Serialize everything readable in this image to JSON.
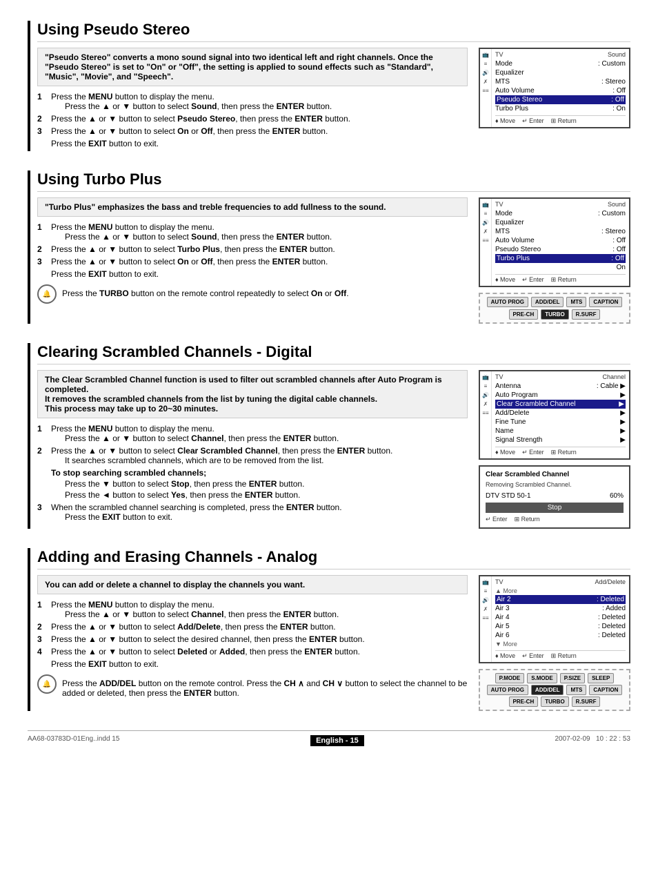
{
  "sections": [
    {
      "id": "pseudo-stereo",
      "title": "Using Pseudo Stereo",
      "intro": "\"Pseudo Stereo\" converts a mono sound signal into two identical left and right channels. Once the \"Pseudo Stereo\" is set to \"On\" or \"Off\", the setting is applied to sound effects such as \"Standard\", \"Music\", \"Movie\", and \"Speech\".",
      "steps": [
        {
          "num": "1",
          "text": "Press the MENU button to display the menu.",
          "sub": "Press the ▲ or ▼ button to select Sound, then press the ENTER button."
        },
        {
          "num": "2",
          "text": "Press the ▲ or ▼ button to select Pseudo Stereo, then press the ENTER button."
        },
        {
          "num": "3",
          "text": "Press the ▲ or ▼ button to select On or Off, then press the ENTER button."
        }
      ],
      "exit": "Press the EXIT button to exit.",
      "screen": {
        "header_left": "TV",
        "header_right": "Sound",
        "rows": [
          {
            "label": "Mode",
            "value": ": Custom",
            "selected": false
          },
          {
            "label": "Equalizer",
            "value": "",
            "selected": false
          },
          {
            "label": "MTS",
            "value": ": Stereo",
            "selected": false
          },
          {
            "label": "Auto Volume",
            "value": ": Off",
            "selected": false
          },
          {
            "label": "Pseudo Stereo",
            "value": ": Off",
            "selected": true
          },
          {
            "label": "Turbo Plus",
            "value": ": On",
            "selected": false
          }
        ],
        "footer": [
          "♦ Move",
          "↵ Enter",
          "⊞ Return"
        ],
        "icons": [
          "TV",
          "≡",
          "♪",
          "✗",
          "≡≡"
        ]
      }
    },
    {
      "id": "turbo-plus",
      "title": "Using Turbo Plus",
      "intro": "\"Turbo Plus\" emphasizes the bass and treble frequencies to add fullness to the sound.",
      "steps": [
        {
          "num": "1",
          "text": "Press the MENU button to display the menu.",
          "sub": "Press the ▲ or ▼ button to select Sound, then press the ENTER button."
        },
        {
          "num": "2",
          "text": "Press the ▲ or ▼ button to select Turbo Plus, then press the ENTER button."
        },
        {
          "num": "3",
          "text": "Press the ▲ or ▼ button to select On or Off, then press the ENTER button."
        }
      ],
      "exit": "Press the EXIT button to exit.",
      "tip": "Press the TURBO button on the remote control repeatedly to select On or Off.",
      "screen": {
        "header_left": "TV",
        "header_right": "Sound",
        "rows": [
          {
            "label": "Mode",
            "value": ": Custom",
            "selected": false
          },
          {
            "label": "Equalizer",
            "value": "",
            "selected": false
          },
          {
            "label": "MTS",
            "value": ": Stereo",
            "selected": false
          },
          {
            "label": "Auto Volume",
            "value": ": Off",
            "selected": false
          },
          {
            "label": "Pseudo Stereo",
            "value": ": Off",
            "selected": false
          },
          {
            "label": "Turbo Plus",
            "value": ": Off",
            "selected": true
          },
          {
            "label": "",
            "value": "On",
            "selected": false
          }
        ],
        "footer": [
          "♦ Move",
          "↵ Enter",
          "⊞ Return"
        ],
        "icons": [
          "TV",
          "≡",
          "♪",
          "✗",
          "≡≡"
        ]
      },
      "remote": {
        "top_buttons": [
          "AUTO PROG",
          "ADD/DEL",
          "MTS",
          "CAPTION"
        ],
        "bottom_buttons": [
          "PRE-CH",
          "TURBO",
          "R.SURF"
        ]
      }
    },
    {
      "id": "clear-scrambled",
      "title": "Clearing Scrambled Channels - Digital",
      "intro_lines": [
        "The Clear Scrambled Channel function is used to filter out scrambled channels after Auto Program is completed.",
        "It removes the scrambled channels from the list by tuning the digital cable channels.",
        "This process may take up to 20~30 minutes."
      ],
      "steps": [
        {
          "num": "1",
          "text": "Press the MENU button to display the menu.",
          "sub": "Press the ▲ or ▼ button to select Channel, then press the ENTER button."
        },
        {
          "num": "2",
          "text": "Press the ▲ or ▼ button to select Clear Scrambled Channel, then press the ENTER button.",
          "sub2": "It searches scrambled channels, which are to be removed from the list."
        },
        {
          "num": "3",
          "text": "When the scrambled channel searching is completed, press the ENTER button.",
          "sub": "Press the EXIT button to exit."
        }
      ],
      "stop_note": {
        "title": "To stop searching scrambled channels;",
        "lines": [
          "Press the ▼ button to select Stop, then press the ENTER button.",
          "Press the ◄ button to select Yes, then press the  ENTER button."
        ]
      },
      "channel_screen": {
        "header_left": "TV",
        "header_right": "Channel",
        "rows": [
          {
            "label": "Antenna",
            "value": ": Cable",
            "arrow": true,
            "selected": false
          },
          {
            "label": "Auto Program",
            "value": "",
            "arrow": true,
            "selected": false
          },
          {
            "label": "Clear Scrambled Channel",
            "value": "",
            "arrow": true,
            "selected": true
          },
          {
            "label": "Add/Delete",
            "value": "",
            "arrow": true,
            "selected": false
          },
          {
            "label": "Fine Tune",
            "value": "",
            "arrow": true,
            "selected": false
          },
          {
            "label": "Name",
            "value": "",
            "arrow": true,
            "selected": false
          },
          {
            "label": "Signal Strength",
            "value": "",
            "arrow": true,
            "selected": false
          }
        ],
        "footer": [
          "♦ Move",
          "↵ Enter",
          "⊞ Return"
        ],
        "icons": [
          "TV",
          "≡",
          "♪",
          "✗",
          "≡≡"
        ]
      },
      "csb_screen": {
        "title": "Clear Scrambled Channel",
        "subtitle": "Removing Scrambled Channel.",
        "channel": "DTV STD 50-1",
        "percent": "60%",
        "stop_btn": "Stop",
        "footer": [
          "↵ Enter",
          "⊞ Return"
        ]
      }
    },
    {
      "id": "add-erase",
      "title": "Adding and Erasing Channels - Analog",
      "intro": "You can add or delete a channel to display the channels you want.",
      "steps": [
        {
          "num": "1",
          "text": "Press the MENU button to display the menu.",
          "sub": "Press the ▲ or ▼ button to select Channel, then press the ENTER button."
        },
        {
          "num": "2",
          "text": "Press the ▲ or ▼ button to select Add/Delete, then press the ENTER button."
        },
        {
          "num": "3",
          "text": "Press the ▲ or ▼ button to select the desired channel, then press the ENTER button."
        },
        {
          "num": "4",
          "text": "Press the ▲ or ▼ button to select Deleted or Added, then press the ENTER button."
        }
      ],
      "exit": "Press the EXIT button to exit.",
      "tip": "Press the ADD/DEL button on the remote control. Press the CH ∧ and CH ∨ button to select the channel to be added or deleted, then press the ENTER button.",
      "ad_screen": {
        "header_left": "TV",
        "header_right": "Add/Delete",
        "more_top": "▲ More",
        "rows": [
          {
            "ch": "Air  2",
            "status": ": Deleted",
            "selected": true
          },
          {
            "ch": "Air  3",
            "status": ": Added",
            "selected": false
          },
          {
            "ch": "Air  4",
            "status": ": Deleted",
            "selected": false
          },
          {
            "ch": "Air  5",
            "status": ": Deleted",
            "selected": false
          },
          {
            "ch": "Air  6",
            "status": ": Deleted",
            "selected": false
          }
        ],
        "more_bottom": "▼ More",
        "footer": [
          "♦ Move",
          "↵ Enter",
          "⊞ Return"
        ],
        "icons": [
          "TV",
          "≡",
          "♪",
          "✗",
          "≡≡"
        ]
      },
      "remote2": {
        "top_buttons_1": [
          "P.MODE",
          "S.MODE",
          "P.SIZE",
          "SLEEP"
        ],
        "top_buttons_2": [
          "AUTO PROG",
          "ADD/DEL",
          "MTS",
          "CAPTION"
        ],
        "bottom_buttons": [
          "PRE-CH",
          "TURBO",
          "R.SURF"
        ]
      }
    }
  ],
  "footer": {
    "badge": "English - 15",
    "file": "AA68-03783D-01Eng..indd   15",
    "date": "2007-02-09",
    "time": "10 : 22 : 53"
  }
}
